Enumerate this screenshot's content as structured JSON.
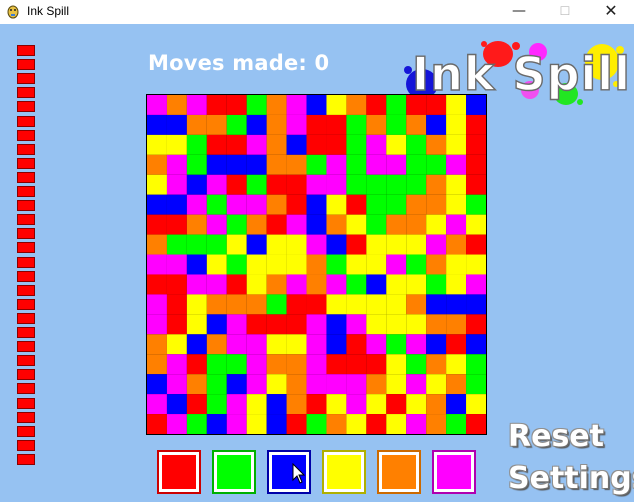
{
  "window": {
    "title": "Ink Spill",
    "minimize_label": "—",
    "maximize_label": "☐",
    "close_label": "✕"
  },
  "header": {
    "moves_label": "Moves made:",
    "moves_count": "0",
    "logo_text": "Ink Spill"
  },
  "lives": {
    "remaining": 30,
    "color": "#ff0000"
  },
  "board": {
    "size": 17,
    "palette": {
      "R": "#ff0000",
      "G": "#00ff00",
      "B": "#0000ff",
      "Y": "#ffff00",
      "O": "#ff8000",
      "P": "#ff00ff"
    },
    "rows": [
      "POPRRGOPBYORGRRYB",
      "BBOOGBOPRRGOGOBYR",
      "YYGRRPOBRRGPYGOYR",
      "OPGBBBOOGPGPPGGPR",
      "YPBPRGRRPPGGGGOYR",
      "BBPGPPORBYRGGOOYG",
      "RROPGORPBOYGOOYPY",
      "OGGGYBYYPBRYYYPOR",
      "PPBYGYYYOGYYPGOYY",
      "RRPPRYOPOPGBYYGYP",
      "PRYOOOGRRYYYYOBBB",
      "PRYBPRRRPBPYYYOOR",
      "OYBOPPYYPBRPGPBRB",
      "OPRGGPOOPRRRYGOYG",
      "BPOGBPYOPPPOYPYOG",
      "PBRGPYBORYPYRYOBY",
      "RPGBPYBRGOYRYPOGR"
    ]
  },
  "palette_buttons": [
    {
      "name": "red",
      "color": "#ff0000",
      "border": "#cc0000"
    },
    {
      "name": "green",
      "color": "#00ff00",
      "border": "#00b000"
    },
    {
      "name": "blue",
      "color": "#0000ff",
      "border": "#0000a8"
    },
    {
      "name": "yellow",
      "color": "#ffff00",
      "border": "#b0b000"
    },
    {
      "name": "orange",
      "color": "#ff8000",
      "border": "#cc6a00"
    },
    {
      "name": "magenta",
      "color": "#ff00ff",
      "border": "#b000b0"
    }
  ],
  "buttons": {
    "reset_label": "Reset",
    "settings_label": "Settings"
  }
}
